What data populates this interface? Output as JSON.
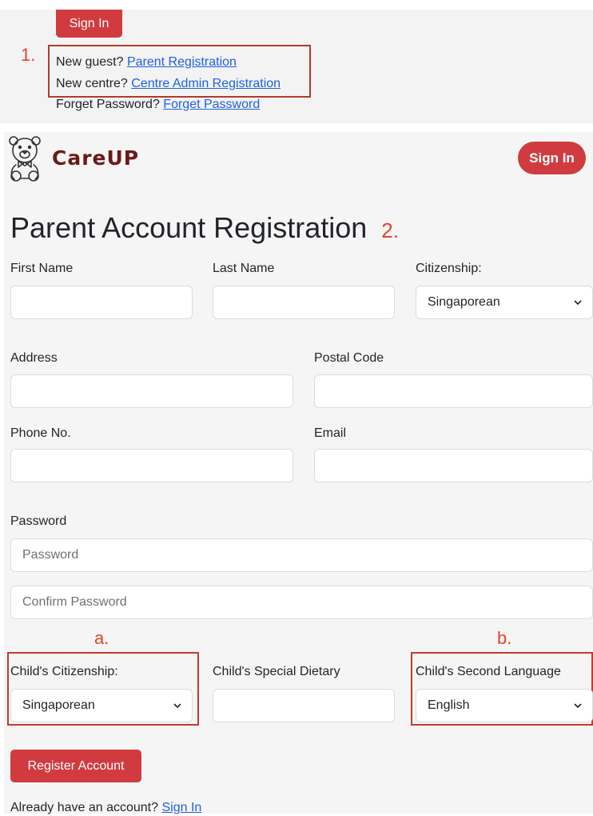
{
  "top_snippet": {
    "sign_in_label": "Sign In",
    "annotation_number": "1.",
    "lines": [
      {
        "prefix": "New guest?",
        "link": "Parent Registration"
      },
      {
        "prefix": "New centre?",
        "link": "Centre Admin Registration"
      },
      {
        "prefix": "Forget Password?",
        "link": "Forget Password"
      }
    ]
  },
  "navbar": {
    "brand": "CareUP",
    "logo_icon": "teddy-bear-icon",
    "sign_in_label": "Sign In"
  },
  "form": {
    "title": "Parent Account Registration",
    "title_annotation": "2.",
    "first_name": {
      "label": "First Name",
      "value": ""
    },
    "last_name": {
      "label": "Last Name",
      "value": ""
    },
    "citizenship": {
      "label": "Citizenship:",
      "value": "Singaporean"
    },
    "address": {
      "label": "Address",
      "value": ""
    },
    "postal_code": {
      "label": "Postal Code",
      "value": ""
    },
    "phone": {
      "label": "Phone No.",
      "value": ""
    },
    "email": {
      "label": "Email",
      "value": ""
    },
    "password": {
      "label": "Password",
      "placeholder": "Password",
      "confirm_placeholder": "Confirm Password"
    },
    "child_citizenship": {
      "annotation": "a.",
      "label": "Child's Citizenship:",
      "value": "Singaporean"
    },
    "child_dietary": {
      "label": "Child's Special Dietary",
      "value": ""
    },
    "child_language": {
      "annotation": "b.",
      "label": "Child's Second Language",
      "value": "English"
    },
    "register_label": "Register Account",
    "footer_prefix": "Already have an account?",
    "footer_link": "Sign In"
  },
  "colors": {
    "accent": "#d13b40",
    "brand": "#6b1a19",
    "link": "#1f5fe6",
    "annotation": "#e4432d"
  }
}
